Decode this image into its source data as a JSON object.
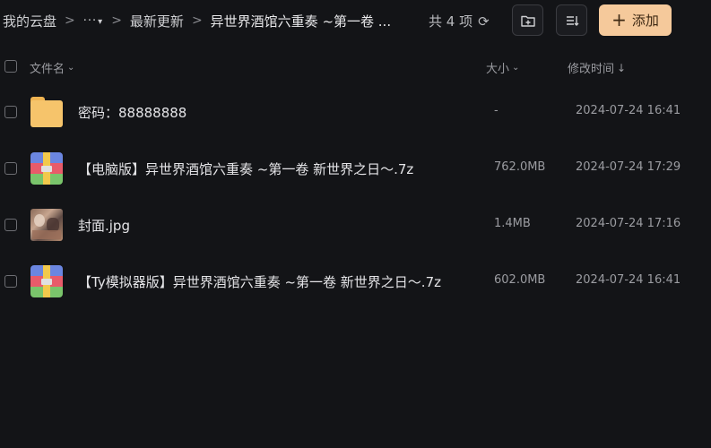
{
  "breadcrumb": {
    "root": "我的云盘",
    "more": "···",
    "parent": "最新更新",
    "current": "异世界酒馆六重奏 ~第一卷 ..."
  },
  "summary": {
    "count_text": "共 4 项"
  },
  "toolbar": {
    "add_label": "添加"
  },
  "columns": {
    "name": "文件名",
    "size": "大小",
    "modified": "修改时间"
  },
  "files": [
    {
      "type": "folder",
      "name": "密码：88888888",
      "size": "-",
      "modified": "2024-07-24 16:41"
    },
    {
      "type": "archive",
      "name": "【电脑版】异世界酒馆六重奏 ~第一卷 新世界之日～.7z",
      "size": "762.0MB",
      "modified": "2024-07-24 17:29"
    },
    {
      "type": "image",
      "name": "封面.jpg",
      "size": "1.4MB",
      "modified": "2024-07-24 17:16"
    },
    {
      "type": "archive",
      "name": "【Ty模拟器版】异世界酒馆六重奏 ~第一卷 新世界之日～.7z",
      "size": "602.0MB",
      "modified": "2024-07-24 16:41"
    }
  ],
  "colors": {
    "background": "#131417",
    "accent": "#f5c99b",
    "folder": "#f6c46b"
  }
}
